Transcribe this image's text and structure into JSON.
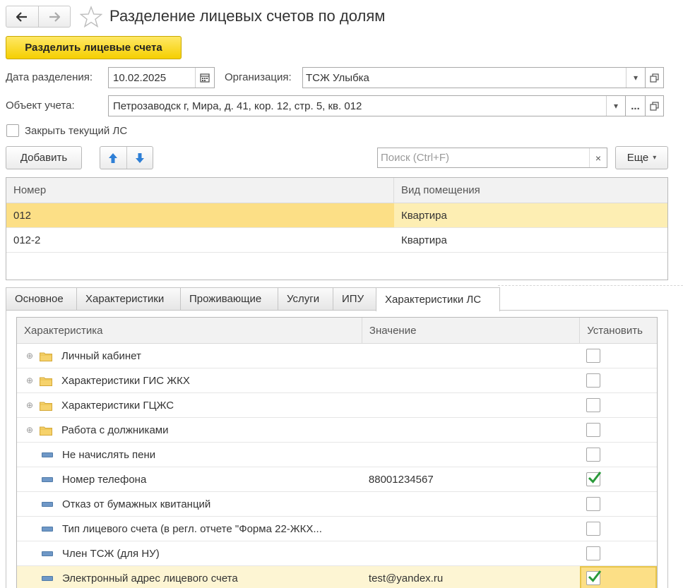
{
  "window": {
    "title": "Разделение лицевых счетов по долям"
  },
  "toolbar": {
    "split_label": "Разделить лицевые счета"
  },
  "form": {
    "date_label": "Дата разделения:",
    "date_value": "10.02.2025",
    "org_label": "Организация:",
    "org_value": "ТСЖ Улыбка",
    "object_label": "Объект учета:",
    "object_value": "Петрозаводск г, Мира, д. 41, кор. 12, стр. 5, кв. 012",
    "object_more": "...",
    "close_label": "Закрыть текущий ЛС",
    "close_checked": false
  },
  "list_toolbar": {
    "add_label": "Добавить",
    "search_placeholder": "Поиск (Ctrl+F)",
    "search_clear": "×",
    "more_label": "Еще"
  },
  "accounts_table": {
    "columns": [
      "Номер",
      "Вид помещения"
    ],
    "rows": [
      {
        "number": "012",
        "type": "Квартира",
        "selected": true
      },
      {
        "number": "012-2",
        "type": "Квартира",
        "selected": false
      }
    ]
  },
  "tabs": [
    {
      "label": "Основное",
      "active": false
    },
    {
      "label": "Характеристики",
      "active": false
    },
    {
      "label": "Проживающие",
      "active": false
    },
    {
      "label": "Услуги",
      "active": false
    },
    {
      "label": "ИПУ",
      "active": false
    },
    {
      "label": "Характеристики ЛС",
      "active": true
    }
  ],
  "characteristics_table": {
    "columns": [
      "Характеристика",
      "Значение",
      "Установить"
    ],
    "rows": [
      {
        "name": "Личный кабинет",
        "kind": "folder",
        "value": "",
        "checked": false,
        "selected": false
      },
      {
        "name": "Характеристики ГИС ЖКХ",
        "kind": "folder",
        "value": "",
        "checked": false,
        "selected": false
      },
      {
        "name": "Характеристики ГЦЖС",
        "kind": "folder",
        "value": "",
        "checked": false,
        "selected": false
      },
      {
        "name": "Работа с должниками",
        "kind": "folder",
        "value": "",
        "checked": false,
        "selected": false
      },
      {
        "name": "Не начислять пени",
        "kind": "property",
        "value": "",
        "checked": false,
        "selected": false
      },
      {
        "name": "Номер телефона",
        "kind": "property",
        "value": "88001234567",
        "checked": true,
        "selected": false
      },
      {
        "name": "Отказ от бумажных квитанций",
        "kind": "property",
        "value": "",
        "checked": false,
        "selected": false
      },
      {
        "name": "Тип лицевого счета (в регл. отчете \"Форма 22-ЖКХ...",
        "kind": "property",
        "value": "",
        "checked": false,
        "selected": false
      },
      {
        "name": "Член ТСЖ (для НУ)",
        "kind": "property",
        "value": "",
        "checked": false,
        "selected": false
      },
      {
        "name": "Электронный адрес лицевого счета",
        "kind": "property",
        "value": "test@yandex.ru",
        "checked": true,
        "selected": true
      }
    ]
  },
  "colors": {
    "accent_yellow": "#f5cf00",
    "selection": "#fcdf86",
    "check_green": "#2a9a3a",
    "arrow_blue": "#2e7fd6"
  }
}
